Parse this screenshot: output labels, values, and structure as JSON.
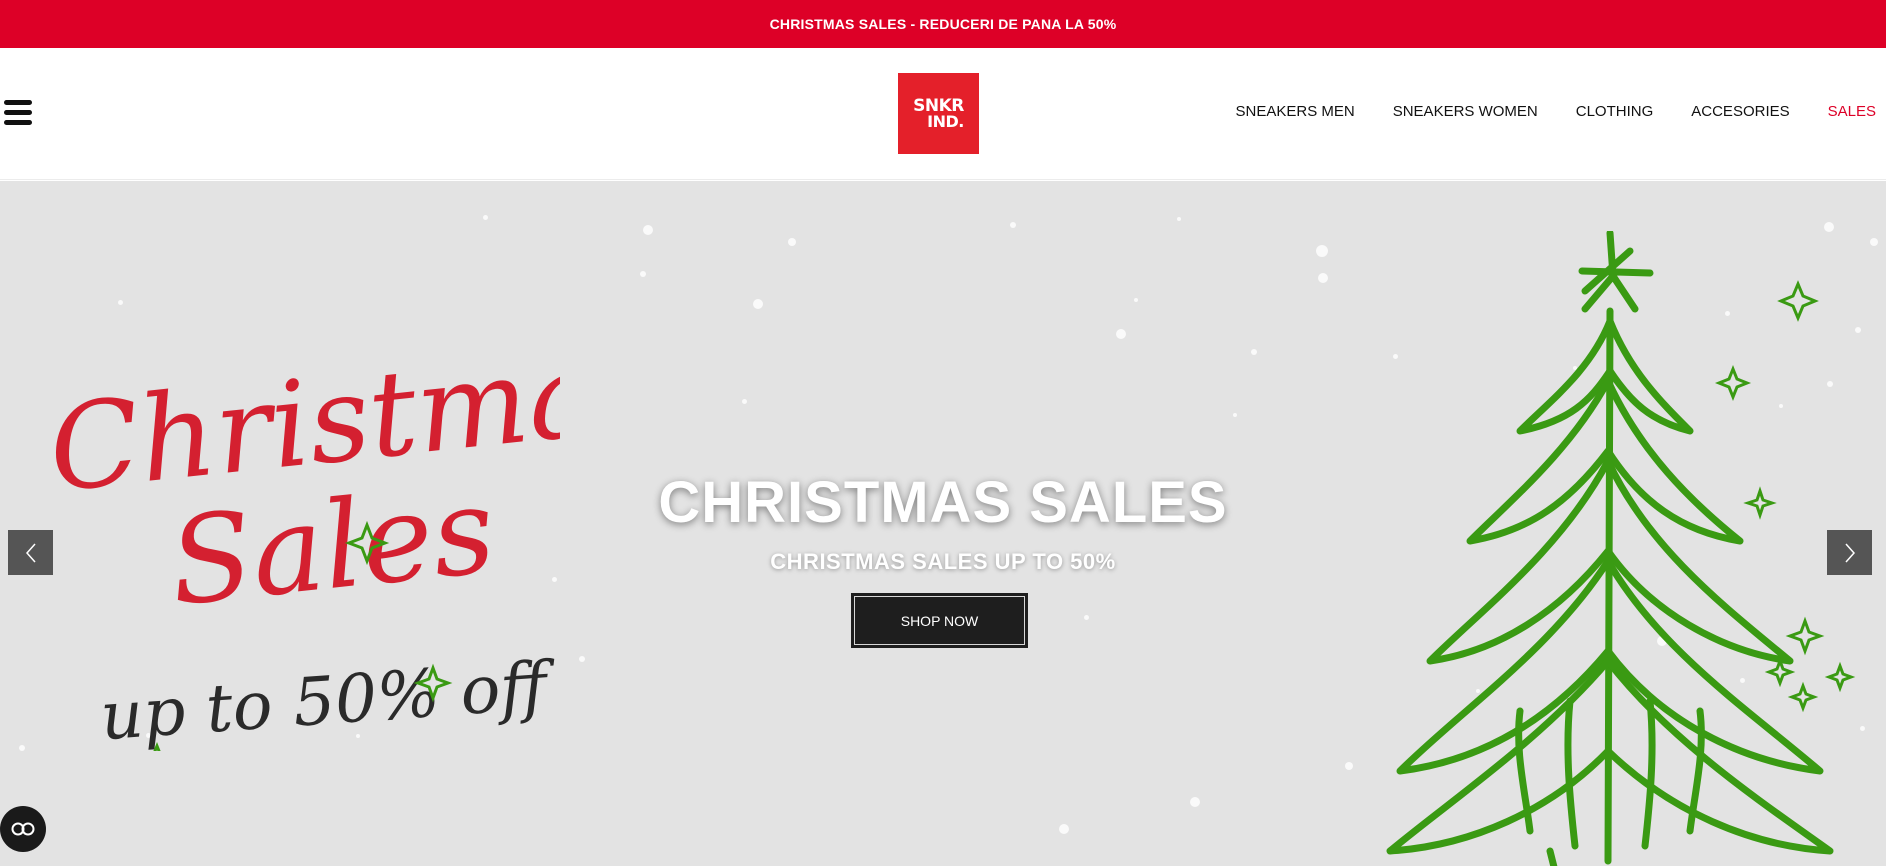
{
  "announcement": {
    "text": "CHRISTMAS SALES - REDUCERI DE PANA LA 50%"
  },
  "header": {
    "logo": {
      "line1": "SNKR",
      "line2": "IND."
    },
    "nav": [
      {
        "label": "SNEAKERS MEN"
      },
      {
        "label": "SNEAKERS WOMEN"
      },
      {
        "label": "CLOTHING"
      },
      {
        "label": "ACCESORIES"
      },
      {
        "label": "SALES"
      }
    ]
  },
  "hero": {
    "title": "CHRISTMAS SALES",
    "subtitle": "CHRISTMAS SALES UP TO 50%",
    "button_label": "SHOP NOW",
    "art_left": {
      "line1": "Christmas",
      "line2": "Sales",
      "line3": "up to 50% off"
    }
  },
  "colors": {
    "brand_red": "#dd0027",
    "logo_red": "#e4202a",
    "tree_green": "#3a9a13",
    "hero_bg": "#e3e3e3",
    "button_bg": "#1e1e1e"
  },
  "icons": {
    "menu": "hamburger-icon",
    "prev": "chevron-left-icon",
    "next": "chevron-right-icon",
    "accessibility": "accessibility-icon"
  }
}
